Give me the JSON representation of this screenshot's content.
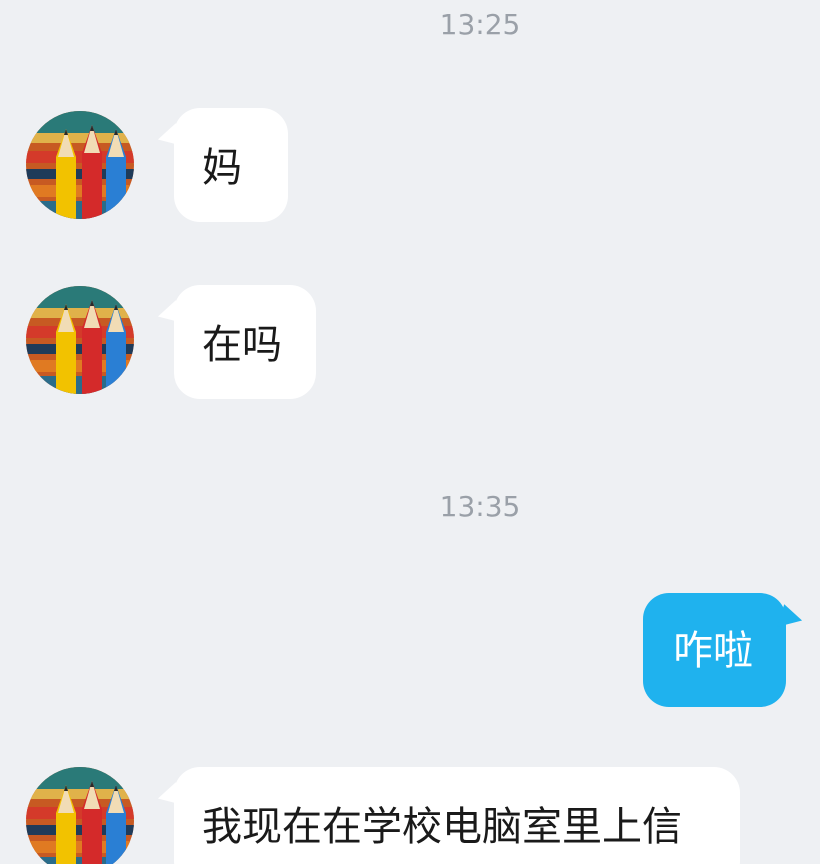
{
  "conversation": {
    "timestamps": [
      "13:25",
      "13:35"
    ],
    "messages": [
      {
        "side": "incoming",
        "text": "妈"
      },
      {
        "side": "incoming",
        "text": "在吗"
      },
      {
        "side": "outgoing",
        "text": "咋啦"
      },
      {
        "side": "incoming",
        "text": "我现在在学校电脑室里上信"
      }
    ]
  },
  "theme": {
    "background": "#eef0f3",
    "incoming_bubble": "#ffffff",
    "outgoing_bubble": "#1fb2ee",
    "timestamp_color": "#9aa0a8"
  },
  "avatar": {
    "icon": "colored-pencils-avatar"
  }
}
